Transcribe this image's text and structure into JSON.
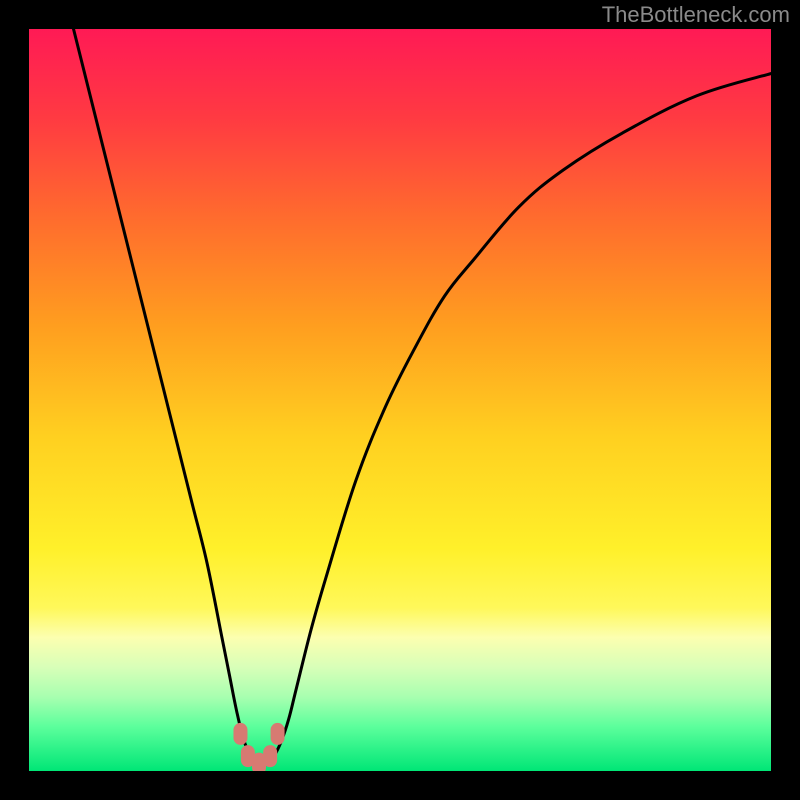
{
  "watermark": "TheBottleneck.com",
  "chart_data": {
    "type": "line",
    "title": "",
    "xlabel": "",
    "ylabel": "",
    "xlim": [
      0,
      100
    ],
    "ylim": [
      0,
      100
    ],
    "grid": false,
    "legend": false,
    "background_gradient": {
      "stops": [
        {
          "offset": 0.0,
          "color": "#ff1a55"
        },
        {
          "offset": 0.12,
          "color": "#ff3a42"
        },
        {
          "offset": 0.25,
          "color": "#ff6a2e"
        },
        {
          "offset": 0.4,
          "color": "#ff9e1f"
        },
        {
          "offset": 0.55,
          "color": "#ffd020"
        },
        {
          "offset": 0.7,
          "color": "#fff02a"
        },
        {
          "offset": 0.78,
          "color": "#fff85a"
        },
        {
          "offset": 0.82,
          "color": "#fcffb0"
        },
        {
          "offset": 0.86,
          "color": "#d8ffb8"
        },
        {
          "offset": 0.9,
          "color": "#a8ffb0"
        },
        {
          "offset": 0.94,
          "color": "#5cff9c"
        },
        {
          "offset": 1.0,
          "color": "#00e676"
        }
      ]
    },
    "series": [
      {
        "name": "bottleneck-curve",
        "color": "#000000",
        "x": [
          6,
          8,
          10,
          12,
          14,
          16,
          18,
          20,
          22,
          24,
          26,
          27,
          28,
          29,
          30,
          31,
          32,
          33,
          34,
          35,
          36,
          38,
          40,
          44,
          48,
          52,
          56,
          60,
          66,
          72,
          80,
          90,
          100
        ],
        "values": [
          100,
          92,
          84,
          76,
          68,
          60,
          52,
          44,
          36,
          28,
          18,
          13,
          8,
          4,
          2,
          1,
          1,
          2,
          4,
          7,
          11,
          19,
          26,
          39,
          49,
          57,
          64,
          69,
          76,
          81,
          86,
          91,
          94
        ]
      }
    ],
    "markers": [
      {
        "x": 28.5,
        "y": 5.0,
        "color": "#d77a72"
      },
      {
        "x": 29.5,
        "y": 2.0,
        "color": "#d77a72"
      },
      {
        "x": 31.0,
        "y": 1.0,
        "color": "#d77a72"
      },
      {
        "x": 32.5,
        "y": 2.0,
        "color": "#d77a72"
      },
      {
        "x": 33.5,
        "y": 5.0,
        "color": "#d77a72"
      }
    ]
  }
}
